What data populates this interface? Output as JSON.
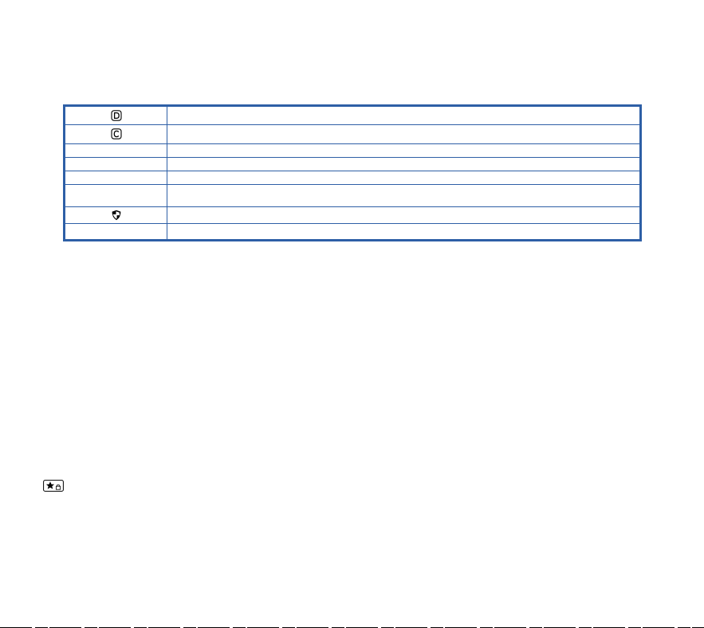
{
  "legend": {
    "rows": [
      {
        "icon": "d-letter-icon",
        "text": ""
      },
      {
        "icon": "c-letter-icon",
        "text": ""
      },
      {
        "icon": "",
        "text": ""
      },
      {
        "icon": "",
        "text": ""
      },
      {
        "icon": "",
        "text": ""
      },
      {
        "icon": "",
        "text": ""
      },
      {
        "icon": "shield-icon",
        "text": ""
      },
      {
        "icon": "",
        "text": ""
      }
    ],
    "border_color": "#2e5fa6"
  },
  "footer": {
    "icon": "star-badge-icon"
  }
}
